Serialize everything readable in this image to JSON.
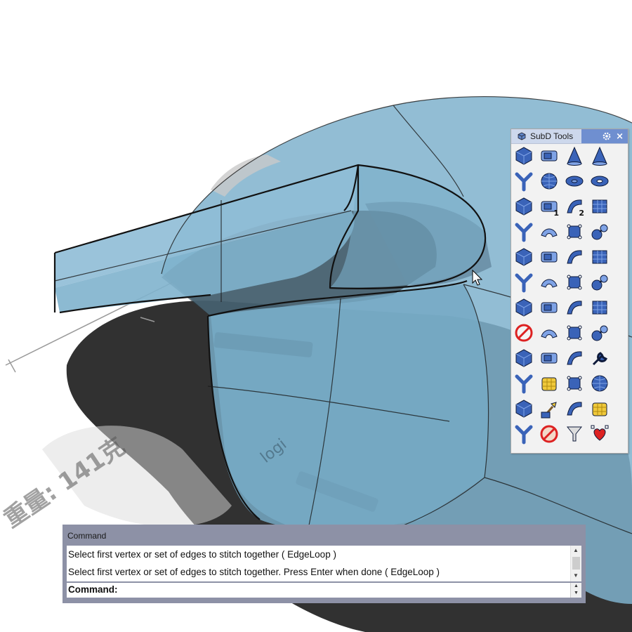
{
  "viewport": {
    "watermark_weight": "重量: 141克",
    "watermark_brand": "logi"
  },
  "subd_panel": {
    "title": "SubD Tools",
    "title_icon": "subd-cube-icon",
    "settings_icon": "gear-icon",
    "close_glyph": "×",
    "tools": [
      {
        "name": "subd-box-hex-icon"
      },
      {
        "name": "subd-plane-icon"
      },
      {
        "name": "subd-cone-icon"
      },
      {
        "name": "subd-truncated-cone-icon"
      },
      {
        "name": "subd-cylinder-icon"
      },
      {
        "name": "subd-sphere-icon"
      },
      {
        "name": "subd-ellipsoid-icon"
      },
      {
        "name": "subd-torus-icon"
      },
      {
        "name": "subd-box-icon"
      },
      {
        "name": "subd-one-rail-sweep-icon",
        "label": "1"
      },
      {
        "name": "subd-two-rail-sweep-icon",
        "label": "2"
      },
      {
        "name": "subd-loft-icon"
      },
      {
        "name": "subd-tri-branch-icon"
      },
      {
        "name": "subd-patch-icon"
      },
      {
        "name": "subd-fold-icon"
      },
      {
        "name": "subd-control-points-icon"
      },
      {
        "name": "subd-bridge-icon"
      },
      {
        "name": "subd-extrude-icon"
      },
      {
        "name": "subd-quad-mesh-icon"
      },
      {
        "name": "subd-weld-sphere-icon"
      },
      {
        "name": "subd-stitch-icon"
      },
      {
        "name": "subd-crease-icon"
      },
      {
        "name": "subd-fill-icon"
      },
      {
        "name": "subd-subdivide-icon"
      },
      {
        "name": "subd-edit-points-icon"
      },
      {
        "name": "subd-bucket-icon"
      },
      {
        "name": "subd-insert-edge-icon"
      },
      {
        "name": "subd-split-icon"
      },
      {
        "name": "subd-delete-face-icon"
      },
      {
        "name": "subd-bevel-icon"
      },
      {
        "name": "subd-smooth-icon"
      },
      {
        "name": "subd-face-select-icon"
      },
      {
        "name": "subd-slide-icon"
      },
      {
        "name": "subd-mesh-panel-icon"
      },
      {
        "name": "subd-edgeloop-list-icon"
      },
      {
        "name": "subd-repair-wrench-icon"
      },
      {
        "name": "subd-convert-icon"
      },
      {
        "name": "subd-cube-yellow-icon"
      },
      {
        "name": "subd-curve-net-icon"
      },
      {
        "name": "subd-sphere-grid-icon"
      },
      {
        "name": "subd-rebuild-icon"
      },
      {
        "name": "subd-paint-brush-icon"
      },
      {
        "name": "subd-star-point-icon"
      },
      {
        "name": "subd-sphere-yellow-icon"
      },
      {
        "name": "subd-star-select-icon"
      },
      {
        "name": "subd-no-display-icon"
      },
      {
        "name": "subd-filter-icon"
      },
      {
        "name": "subd-heart-points-icon"
      }
    ]
  },
  "command": {
    "title": "Command",
    "history": [
      "Select first vertex or set of edges to stitch together ( EdgeLoop )",
      "Select first vertex or set of edges to stitch together. Press Enter when done ( EdgeLoop )"
    ],
    "prompt": "Command:",
    "input_value": "",
    "scroll_up": "▲",
    "scroll_down": "▼"
  },
  "colors": {
    "subd_blue": "#7fb1cc",
    "panel_accent": "#6f8fd0",
    "command_frame": "#8d91a6"
  }
}
